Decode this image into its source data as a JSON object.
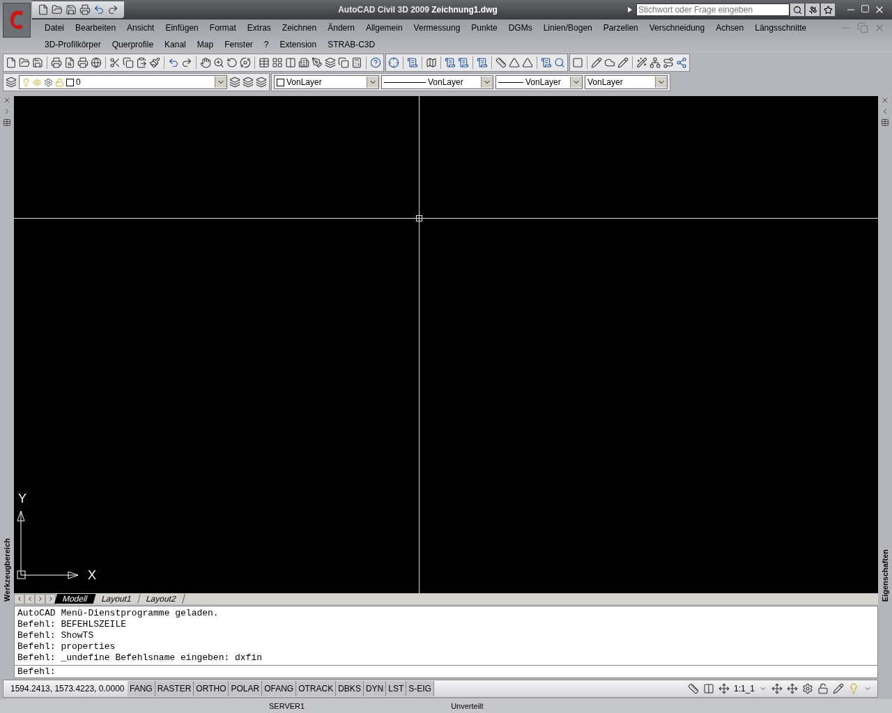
{
  "title_bar": {
    "title": "AutoCAD Civil 3D 2009",
    "document": "Zeichnung1.dwg",
    "search_placeholder": "Stichwort oder Frage eingeben"
  },
  "menu_rows": [
    [
      "Datei",
      "Bearbeiten",
      "Ansicht",
      "Einfügen",
      "Format",
      "Extras",
      "Zeichnen",
      "Ändern",
      "Allgemein",
      "Vermessung",
      "Punkte",
      "DGMs",
      "Linien/Bogen",
      "Parzellen",
      "Verschneidung",
      "Achsen",
      "Längsschnitte"
    ],
    [
      "3D-Profilkörper",
      "Querprofile",
      "Kanal",
      "Map",
      "Fenster",
      "?",
      "Extension",
      "STRAB-C3D"
    ]
  ],
  "layer_toolbar": {
    "layer": "0"
  },
  "properties_toolbar": {
    "color_setting": "VonLayer",
    "linetype": "VonLayer",
    "lineweight": "VonLayer",
    "plot_style": "VonLayer"
  },
  "left_palette": {
    "label": "Werkzeugbereich"
  },
  "right_palette": {
    "label": "Eigenschaften"
  },
  "ucs_icon": {
    "x_label": "X",
    "y_label": "Y"
  },
  "layout_tabs": [
    {
      "label": "Modell",
      "selected": true
    },
    {
      "label": "Layout1",
      "selected": false
    },
    {
      "label": "Layout2",
      "selected": false
    }
  ],
  "command_history": [
    "AutoCAD Menü-Dienstprogramme geladen.",
    "Befehl: BEFEHLSZEILE",
    "Befehl: ShowTS",
    "Befehl: properties",
    "Befehl: _undefine Befehlsname eingeben: dxfin"
  ],
  "command_prompt": "Befehl:",
  "status_bar": {
    "coordinates": "1594.2413, 1573.4223, 0.0000",
    "toggles": [
      "FANG",
      "RASTER",
      "ORTHO",
      "POLAR",
      "OFANG",
      "OTRACK",
      "DBKS",
      "DYN",
      "LST",
      "S-EIG"
    ],
    "annotation_scale": "1:1_1"
  },
  "taskbar": [
    "SERVER1",
    "Unverteilt"
  ]
}
